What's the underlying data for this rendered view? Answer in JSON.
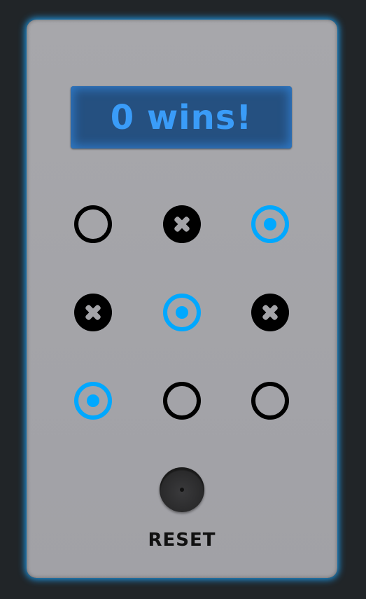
{
  "display": {
    "text": "0 wins!"
  },
  "board": [
    [
      "empty",
      "x",
      "o"
    ],
    [
      "x",
      "o",
      "x"
    ],
    [
      "o",
      "empty",
      "empty"
    ]
  ],
  "reset": {
    "label": "RESET"
  },
  "colors": {
    "accent": "#00a8ff",
    "display_text": "#3a9cf8",
    "panel": "#a4a4a8"
  }
}
